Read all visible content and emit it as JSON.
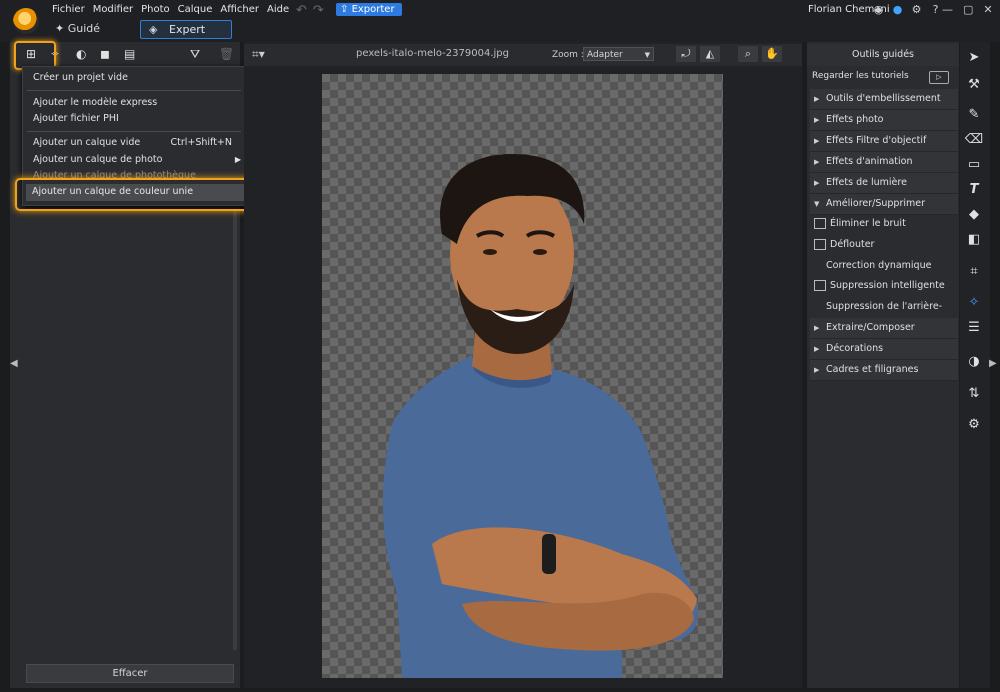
{
  "menu": [
    "Fichier",
    "Modifier",
    "Photo",
    "Calque",
    "Afficher",
    "Aide"
  ],
  "export_label": "Exporter",
  "user_name": "Florian Chemani",
  "mode": {
    "guided": "Guidé",
    "expert": "Expert"
  },
  "layer_menu": {
    "items": [
      {
        "label": "Créer un projet vide"
      },
      {
        "label": "Ajouter le modèle express"
      },
      {
        "label": "Ajouter fichier PHI"
      },
      {
        "label": "Ajouter un calque vide",
        "shortcut": "Ctrl+Shift+N"
      },
      {
        "label": "Ajouter un calque de photo"
      },
      {
        "label": "Ajouter un calque de photothèque"
      },
      {
        "label": "Ajouter un calque de couleur unie"
      }
    ]
  },
  "clear_button": "Effacer",
  "document": {
    "filename": "pexels-italo-melo-2379004.jpg",
    "zoom_label": "Zoom :",
    "zoom_value": "Adapter"
  },
  "right_panel": {
    "title": "Outils guidés",
    "tutorials": "Regarder les tutoriels",
    "categories": [
      {
        "label": "Outils d'embellissement"
      },
      {
        "label": "Effets photo"
      },
      {
        "label": "Effets Filtre d'objectif"
      },
      {
        "label": "Effets d'animation"
      },
      {
        "label": "Effets de lumière"
      },
      {
        "label": "Améliorer/Supprimer"
      }
    ],
    "subitems": [
      {
        "label": "Éliminer le bruit"
      },
      {
        "label": "Déflouter"
      },
      {
        "label": "Correction dynamique"
      },
      {
        "label": "Suppression intelligente"
      },
      {
        "label": "Suppression de l'arrière-plan"
      }
    ],
    "categories2": [
      {
        "label": "Extraire/Composer"
      },
      {
        "label": "Décorations"
      },
      {
        "label": "Cadres et filigranes"
      }
    ]
  },
  "colors": {
    "accent": "#2d7be0",
    "highlight": "#f0a21b",
    "skin": "#b9794c",
    "shirt": "#4a6a9a"
  }
}
